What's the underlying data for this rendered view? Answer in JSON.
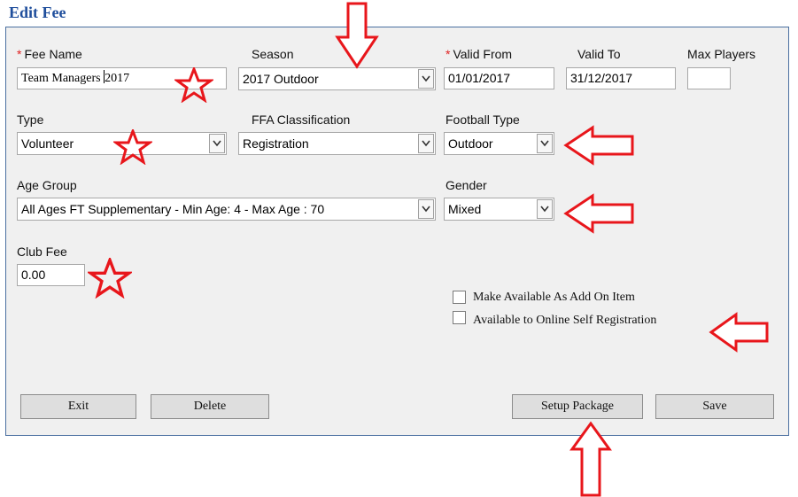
{
  "page_title": "Edit Fee",
  "labels": {
    "fee_name": "Fee Name",
    "season": "Season",
    "valid_from": "Valid From",
    "valid_to": "Valid To",
    "max_players": "Max Players",
    "type": "Type",
    "ffa_classification": "FFA Classification",
    "football_type": "Football Type",
    "age_group": "Age Group",
    "gender": "Gender",
    "club_fee": "Club Fee"
  },
  "required_marker": "*",
  "fields": {
    "fee_name_before_cursor": "Team Managers ",
    "fee_name_after_cursor": "2017",
    "season": "2017 Outdoor",
    "valid_from": "01/01/2017",
    "valid_to": "31/12/2017",
    "max_players": "",
    "type": "Volunteer",
    "ffa_classification": "Registration",
    "football_type": "Outdoor",
    "age_group": "All Ages FT Supplementary - Min Age: 4 - Max Age : 70",
    "gender": "Mixed",
    "club_fee": "0.00"
  },
  "checkboxes": {
    "add_on_item": {
      "label": "Make Available As Add On Item",
      "checked": false
    },
    "online_self_registration": {
      "label": "Available to Online Self Registration",
      "checked": false
    }
  },
  "buttons": {
    "exit": "Exit",
    "delete": "Delete",
    "setup_package": "Setup Package",
    "save": "Save"
  },
  "colors": {
    "title": "#1f4e9c",
    "panel_bg": "#f0f0f0",
    "panel_border": "#4a6fa0",
    "required": "#e02020",
    "annotation": "#e8161b"
  },
  "annotations": [
    "arrow-down",
    "arrow-left",
    "arrow-left",
    "arrow-left",
    "arrow-up",
    "star",
    "star",
    "star"
  ]
}
